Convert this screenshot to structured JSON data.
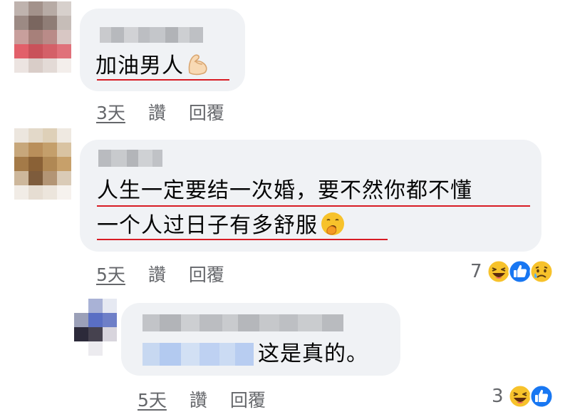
{
  "comments": [
    {
      "text_lines": [
        "加油男人"
      ],
      "emoji": "flexed-biceps-icon",
      "time": "3天",
      "like": "讚",
      "reply": "回覆"
    },
    {
      "text_lines": [
        "人生一定要结一次婚，要不然你都不懂",
        "一个人过日子有多舒服"
      ],
      "emoji": "yawning-face-icon",
      "time": "5天",
      "like": "讚",
      "reply": "回覆",
      "reaction_count": "7",
      "reaction_icons": [
        "haha-icon",
        "like-icon",
        "sad-icon"
      ]
    }
  ],
  "reply": {
    "text": "这是真的。",
    "time": "5天",
    "like": "讚",
    "reply": "回覆",
    "reaction_count": "3",
    "reaction_icons": [
      "haha-icon",
      "like-icon"
    ]
  },
  "colors": {
    "bubble": "#f0f2f5",
    "meta_text": "#65676b",
    "annotation_underline": "#d81c24",
    "like_blue": "#1877f2",
    "haha_yellow": "#f7c22b"
  }
}
